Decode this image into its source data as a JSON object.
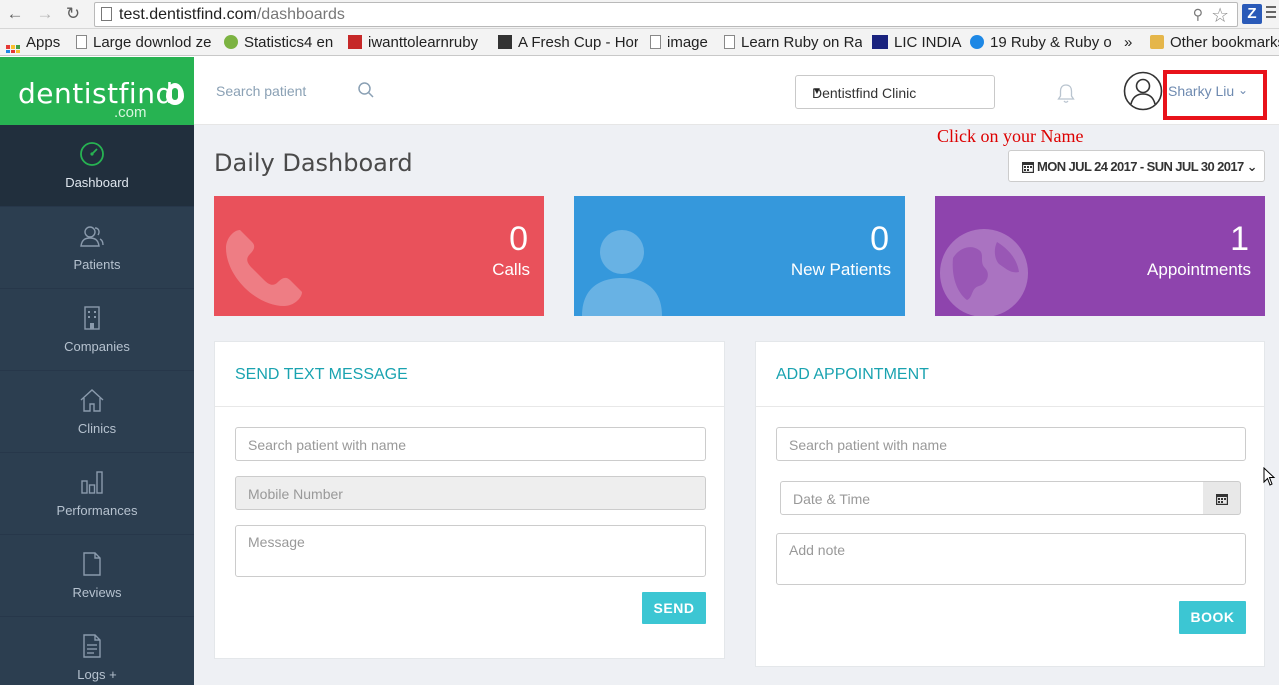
{
  "browser": {
    "url_host": "test.dentistfind.com",
    "url_path": "/dashboards",
    "bookmarks": [
      {
        "label": "Apps",
        "icon": "apps-grid-icon"
      },
      {
        "label": "Large downlod ze",
        "icon": "page-icon"
      },
      {
        "label": "Statistics4 en",
        "icon": "statistics-favicon"
      },
      {
        "label": "iwanttolearnruby",
        "icon": "ruby-favicon"
      },
      {
        "label": "A Fresh Cup - Hor",
        "icon": "cube-favicon"
      },
      {
        "label": "image",
        "icon": "page-icon"
      },
      {
        "label": "Learn Ruby on Ra",
        "icon": "page-icon"
      },
      {
        "label": "LIC INDIA",
        "icon": "lic-favicon"
      },
      {
        "label": "19 Ruby & Ruby o",
        "icon": "stackoverflow-favicon"
      }
    ],
    "more": "»",
    "other_bookmarks": "Other bookmarks"
  },
  "brand": {
    "name": "dentistfind",
    "suffix": ".com",
    "color": "#27b352"
  },
  "topbar": {
    "search_placeholder": "Search patient",
    "clinic": "Dentistfind Clinic",
    "user_name": "Sharky Liu"
  },
  "annotation": {
    "text": "Click on your Name",
    "color": "#e8121a"
  },
  "sidebar": {
    "items": [
      {
        "label": "Dashboard",
        "icon": "speedometer-icon",
        "active": true
      },
      {
        "label": "Patients",
        "icon": "users-icon"
      },
      {
        "label": "Companies",
        "icon": "building-icon"
      },
      {
        "label": "Clinics",
        "icon": "home-icon"
      },
      {
        "label": "Performances",
        "icon": "bar-chart-icon"
      },
      {
        "label": "Reviews",
        "icon": "document-icon"
      },
      {
        "label": "Logs +",
        "icon": "log-file-icon"
      }
    ]
  },
  "dashboard": {
    "title": "Daily Dashboard",
    "date_range": "MON JUL 24 2017 - SUN JUL 30 2017",
    "stats": [
      {
        "value": "0",
        "label": "Calls",
        "color": "#e9515b",
        "icon": "phone-icon"
      },
      {
        "value": "0",
        "label": "New Patients",
        "color": "#3598dc",
        "icon": "user-icon"
      },
      {
        "value": "1",
        "label": "Appointments",
        "color": "#8e44ad",
        "icon": "globe-icon"
      }
    ]
  },
  "send_text": {
    "title": "SEND TEXT MESSAGE",
    "patient_placeholder": "Search patient with name",
    "mobile_placeholder": "Mobile Number",
    "message_placeholder": "Message",
    "send_label": "SEND"
  },
  "add_appointment": {
    "title": "ADD APPOINTMENT",
    "patient_placeholder": "Search patient with name",
    "datetime_placeholder": "Date & Time",
    "note_placeholder": "Add note",
    "book_label": "BOOK"
  }
}
